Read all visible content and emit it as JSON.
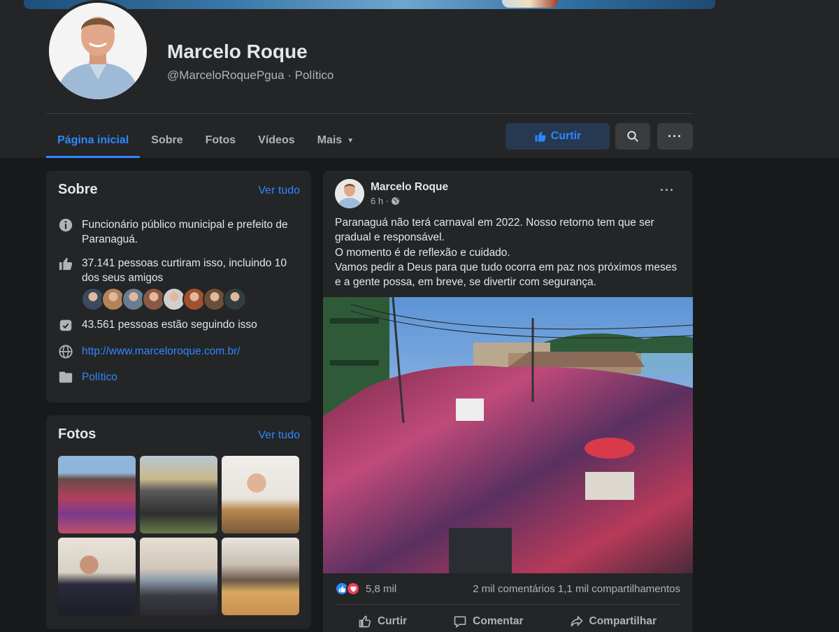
{
  "profile": {
    "name": "Marcelo Roque",
    "subtitle": "@MarceloRoquePgua · Político"
  },
  "tabs": [
    {
      "label": "Página inicial",
      "active": true
    },
    {
      "label": "Sobre"
    },
    {
      "label": "Fotos"
    },
    {
      "label": "Vídeos"
    },
    {
      "label": "Mais"
    }
  ],
  "actions": {
    "like_label": "Curtir",
    "search_icon": "search-icon",
    "more_label": "···"
  },
  "about": {
    "title": "Sobre",
    "see_all": "Ver tudo",
    "description": "Funcionário público municipal e prefeito de Paranaguá.",
    "likes": "37.141 pessoas curtiram isso, incluindo 10 dos seus amigos",
    "followers": "43.561 pessoas estão seguindo isso",
    "website": "http://www.marceloroque.com.br/",
    "category": "Político",
    "friend_avatar_colors": [
      "#3b4a5e",
      "#b5835a",
      "#6a7d92",
      "#8a5a44",
      "#cfcfcf",
      "#a0522d",
      "#6b4f3a",
      "#2f3f3f"
    ]
  },
  "photos": {
    "title": "Fotos",
    "see_all": "Ver tudo"
  },
  "post": {
    "author": "Marcelo Roque",
    "time": "6 h ·",
    "menu": "···",
    "text_lines": [
      "Paranaguá não terá carnaval em 2022. Nosso retorno tem que ser",
      "gradual e responsável.",
      "O momento é de reflexão e cuidado.",
      "Vamos pedir a Deus para que tudo ocorra em paz nos próximos meses",
      "e a gente possa, em breve, se divertir com segurança."
    ],
    "reactions_count": "5,8 mil",
    "stats": "2 mil comentários  1,1 mil compartilhamentos",
    "actions": [
      "Curtir",
      "Comentar",
      "Compartilhar"
    ]
  },
  "colors": {
    "accent": "#2d88ff",
    "background": "#18191a",
    "surface": "#242526"
  }
}
